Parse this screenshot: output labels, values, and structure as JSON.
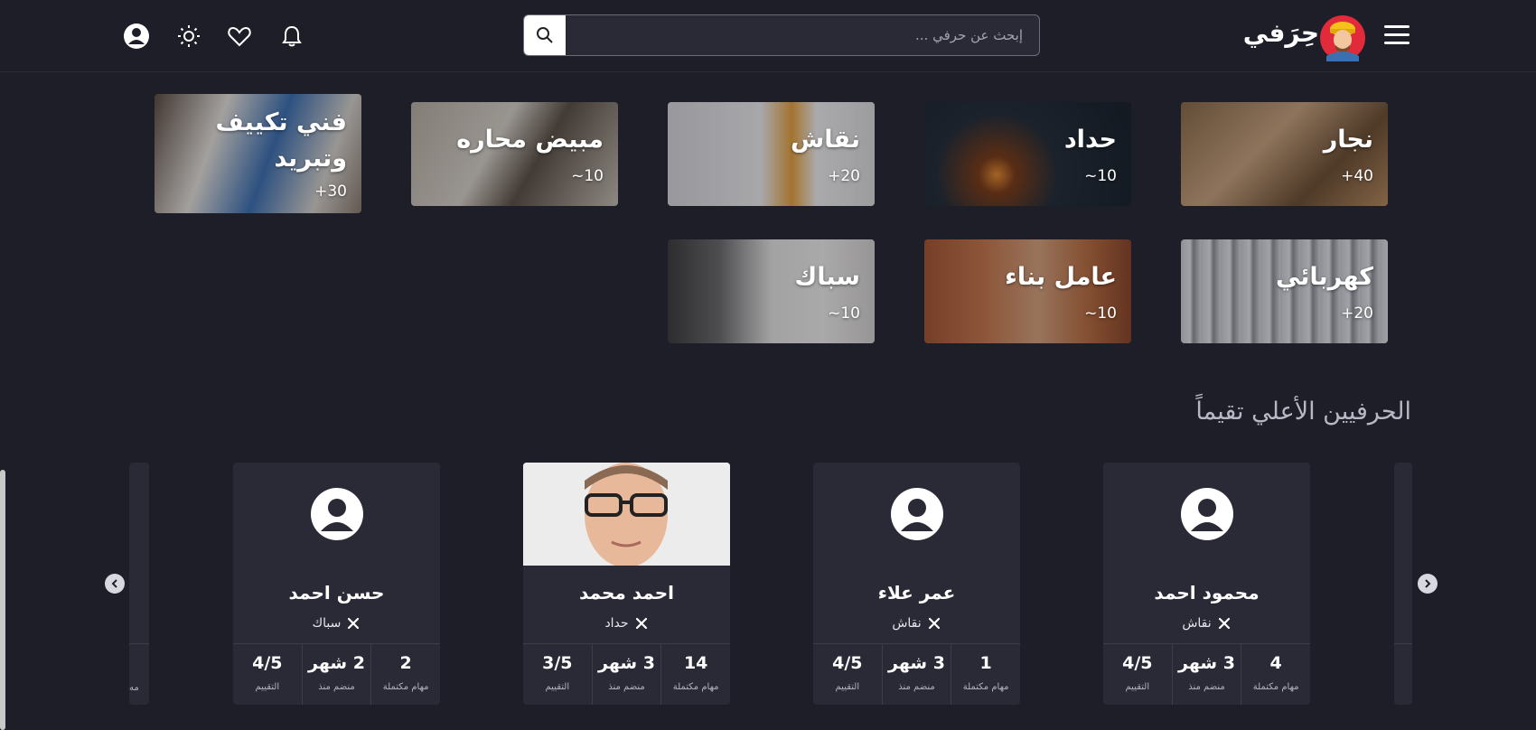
{
  "header": {
    "logo_text": "حِرَفي",
    "search": {
      "placeholder": "إبحث عن حرفي ...",
      "value": ""
    },
    "icons": [
      "menu-icon",
      "search-icon",
      "bell-icon",
      "heart-icon",
      "sun-icon",
      "user-icon"
    ]
  },
  "categories": [
    {
      "title": "نجار",
      "count": "+40"
    },
    {
      "title": "حداد",
      "count": "~10"
    },
    {
      "title": "نقاش",
      "count": "+20"
    },
    {
      "title": "مبيض محاره",
      "count": "~10"
    },
    {
      "title": "فني تكييف وتبريد",
      "count": "+30"
    },
    {
      "title": "كهربائي",
      "count": "+20"
    },
    {
      "title": "عامل بناء",
      "count": "~10"
    },
    {
      "title": "سباك",
      "count": "~10"
    }
  ],
  "top_rated": {
    "title": "الحرفيين الأعلي تقيماً",
    "craftsmen": [
      {
        "name": "محمود احمد",
        "trade": "نقاش",
        "tasks": "4",
        "tasks_label": "مهام مكتملة",
        "joined": "3 شهر",
        "joined_label": "منضم منذ",
        "rating": "4/5",
        "rating_label": "التقييم"
      },
      {
        "name": "عمر علاء",
        "trade": "نقاش",
        "tasks": "1",
        "tasks_label": "مهام مكتملة",
        "joined": "3 شهر",
        "joined_label": "منضم منذ",
        "rating": "4/5",
        "rating_label": "التقييم"
      },
      {
        "name": "احمد محمد",
        "trade": "حداد",
        "tasks": "14",
        "tasks_label": "مهام مكتملة",
        "joined": "3 شهر",
        "joined_label": "منضم منذ",
        "rating": "3/5",
        "rating_label": "التقييم"
      },
      {
        "name": "حسن احمد",
        "trade": "سباك",
        "tasks": "2",
        "tasks_label": "مهام مكتملة",
        "joined": "2 شهر",
        "joined_label": "منضم منذ",
        "rating": "4/5",
        "rating_label": "التقييم"
      }
    ],
    "partial_label": "مه"
  },
  "colors": {
    "background": "#1e1e29",
    "card": "#2a2a36",
    "text": "#ffffff",
    "muted": "#b8b8c4"
  }
}
